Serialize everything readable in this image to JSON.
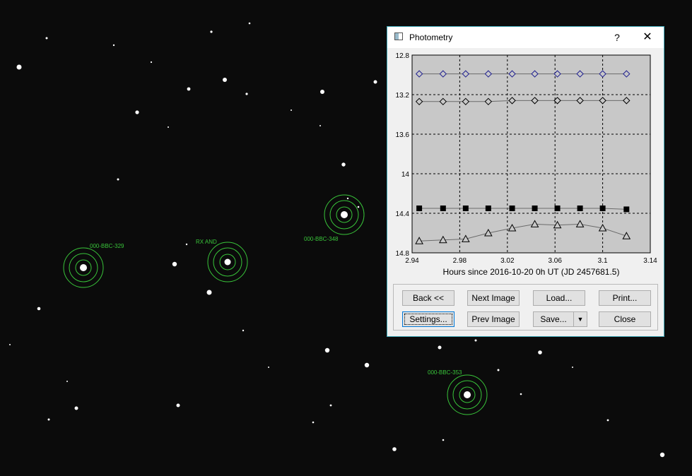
{
  "dialog": {
    "title": "Photometry",
    "help_glyph": "?",
    "close_glyph": "✕"
  },
  "labels": {
    "rx_and": "RX AND",
    "bbc329": "000-BBC-329",
    "bbc348": "000-BBC-348",
    "bbc353": "000-BBC-353"
  },
  "buttons": {
    "back": "Back <<",
    "next_image": "Next Image",
    "load": "Load...",
    "print": "Print...",
    "settings": "Settings...",
    "prev_image": "Prev Image",
    "save": "Save...",
    "close": "Close"
  },
  "colors": {
    "plot_bg": "#c8c8c8",
    "blue_series": "#1f1f8f",
    "aperture": "#39c43a"
  },
  "chart_data": {
    "type": "scatter",
    "xlabel": "Hours since 2016-10-20 0h UT (JD 2457681.5)",
    "ylabel": "",
    "xlim": [
      2.94,
      3.14
    ],
    "ylim": [
      12.8,
      14.8
    ],
    "y_inverted": true,
    "grid": true,
    "x_ticks": [
      "2.94",
      "2.98",
      "3.02",
      "3.06",
      "3.1",
      "3.14"
    ],
    "y_ticks": [
      "12.8",
      "13.2",
      "13.6",
      "14",
      "14.4",
      "14.8"
    ],
    "x": [
      2.946,
      2.966,
      2.985,
      3.004,
      3.024,
      3.043,
      3.062,
      3.081,
      3.1,
      3.12
    ],
    "series": [
      {
        "marker": "diamond-open",
        "color": "#1f1f8f",
        "values": [
          12.99,
          12.99,
          12.99,
          12.99,
          12.99,
          12.99,
          12.99,
          12.99,
          12.99,
          12.99
        ]
      },
      {
        "marker": "diamond-open",
        "color": "#000000",
        "values": [
          13.27,
          13.27,
          13.27,
          13.27,
          13.26,
          13.26,
          13.26,
          13.26,
          13.26,
          13.26
        ]
      },
      {
        "marker": "square-filled",
        "color": "#000000",
        "values": [
          14.35,
          14.35,
          14.35,
          14.35,
          14.35,
          14.35,
          14.35,
          14.35,
          14.35,
          14.36
        ]
      },
      {
        "marker": "triangle-open",
        "color": "#000000",
        "values": [
          14.68,
          14.67,
          14.66,
          14.6,
          14.55,
          14.51,
          14.52,
          14.51,
          14.55,
          14.63
        ]
      }
    ]
  }
}
